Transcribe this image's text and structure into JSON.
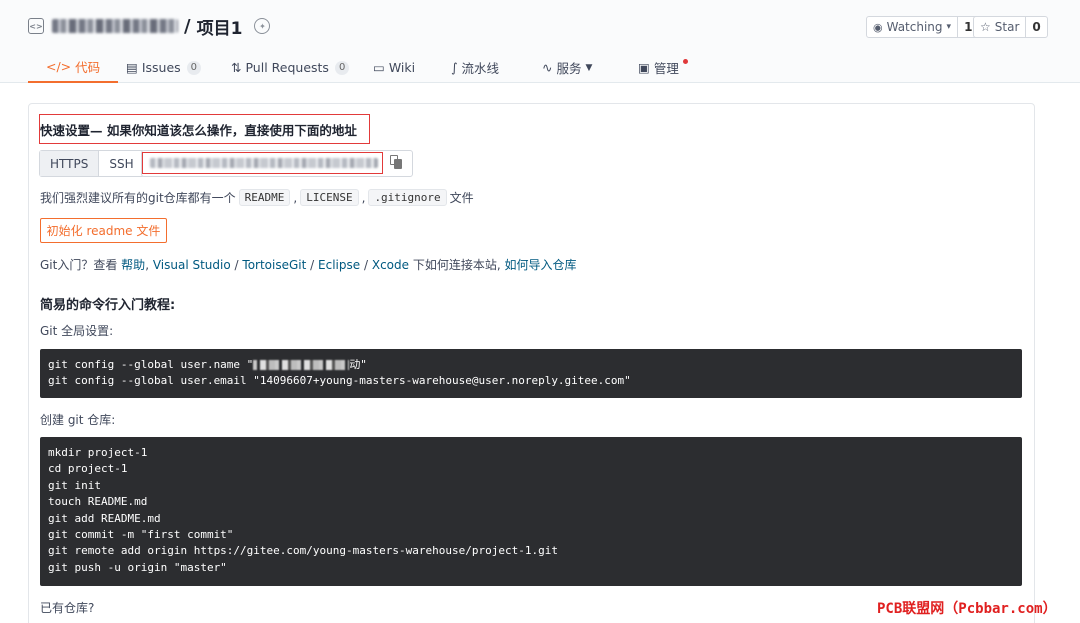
{
  "repo": {
    "name": "项目1",
    "slash": "/",
    "watch_label": "Watching",
    "watch_count": "1",
    "star_label": "Star",
    "star_count": "0"
  },
  "tabs": [
    {
      "label": "代码",
      "icon": "code-icon",
      "active": true
    },
    {
      "label": "Issues",
      "count": "0",
      "icon": "issues-icon"
    },
    {
      "label": "Pull Requests",
      "count": "0",
      "icon": "pull-request-icon"
    },
    {
      "label": "Wiki",
      "icon": "wiki-icon"
    },
    {
      "label": "流水线",
      "icon": "pipeline-icon"
    },
    {
      "label": "服务",
      "icon": "service-icon",
      "dropdown": true
    },
    {
      "label": "管理",
      "icon": "manage-icon",
      "dot": true
    }
  ],
  "quick_setup": {
    "title": "快速设置— 如果你知道该怎么操作，直接使用下面的地址",
    "https": "HTTPS",
    "ssh": "SSH",
    "suggest_prefix": "我们强烈建议所有的git仓库都有一个",
    "file_readme": "README",
    "file_license": "LICENSE",
    "file_gitignore": ".gitignore",
    "suggest_suffix": "文件",
    "comma": ",",
    "init_button": "初始化 readme 文件"
  },
  "git_intro": {
    "prefix": "Git入门？查看",
    "help": "帮助",
    "sep1": ",",
    "vs": "Visual Studio",
    "slash": "/",
    "tortoise": "TortoiseGit",
    "eclipse": "Eclipse",
    "xcode": "Xcode",
    "middle": "下如何连接本站,",
    "import": "如何导入仓库"
  },
  "tutorial": {
    "title": "简易的命令行入门教程:",
    "global_label": "Git 全局设置:",
    "global_line1_prefix": "git config --global user.name \"",
    "global_line1_suffix": "动\"",
    "global_line2": "git config --global user.email \"14096607+young-masters-warehouse@user.noreply.gitee.com\"",
    "create_label": "创建 git 仓库:",
    "create_lines": [
      "mkdir project-1",
      "cd project-1",
      "git init",
      "touch README.md",
      "git add README.md",
      "git commit -m \"first commit\"",
      "git remote add origin https://gitee.com/young-masters-warehouse/project-1.git",
      "git push -u origin \"master\""
    ],
    "exists_label": "已有仓库?"
  },
  "watermark": "PCB联盟网（Pcbbar.com）",
  "colors": {
    "accent": "#f36e2e",
    "highlight": "#e23a3a",
    "code_bg": "#2c2d30",
    "link": "#005980"
  }
}
